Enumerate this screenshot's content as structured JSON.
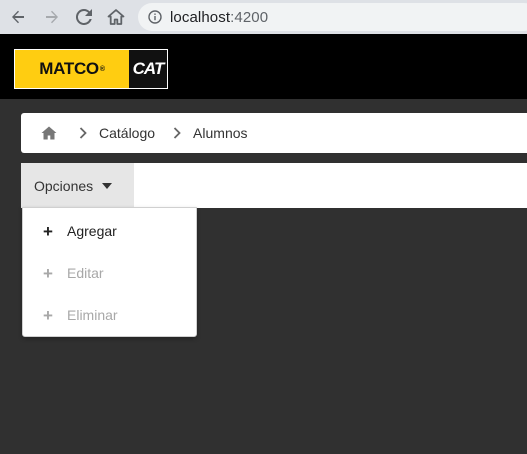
{
  "browser": {
    "url_host": "localhost",
    "url_port": ":4200"
  },
  "header": {
    "logo_matco": "MATCO",
    "logo_registered": "®",
    "logo_cat": "CAT"
  },
  "breadcrumb": {
    "items": [
      "Catálogo",
      "Alumnos"
    ]
  },
  "toolbar": {
    "options_label": "Opciones"
  },
  "menu": {
    "items": [
      {
        "icon": "+",
        "label": "Agregar",
        "enabled": true
      },
      {
        "icon": "+",
        "label": "Editar",
        "enabled": false
      },
      {
        "icon": "+",
        "label": "Eliminar",
        "enabled": false
      }
    ]
  },
  "colors": {
    "brand_yellow": "#ffcd11",
    "background": "#303030",
    "header": "#000000",
    "disabled_text": "#a8a8a8"
  }
}
